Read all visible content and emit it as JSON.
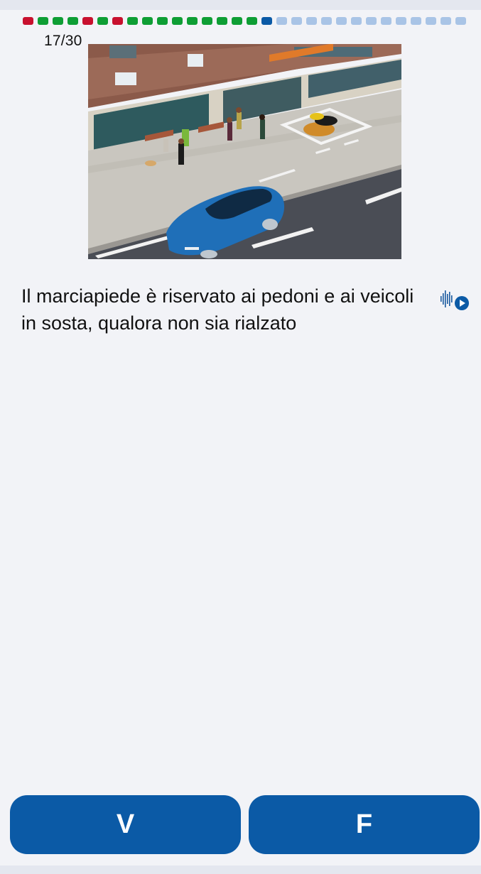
{
  "progress": {
    "counter": "17/30",
    "current": 17,
    "total": 30,
    "states": [
      "wrong",
      "correct",
      "correct",
      "correct",
      "wrong",
      "correct",
      "wrong",
      "correct",
      "correct",
      "correct",
      "correct",
      "correct",
      "correct",
      "correct",
      "correct",
      "correct",
      "current",
      "pending",
      "pending",
      "pending",
      "pending",
      "pending",
      "pending",
      "pending",
      "pending",
      "pending",
      "pending",
      "pending",
      "pending",
      "pending"
    ],
    "colors": {
      "wrong": "#c8102e",
      "correct": "#0e9e34",
      "current": "#0b5aa6",
      "pending": "#a9c4e6"
    }
  },
  "question": {
    "text": "Il marciapiede è riservato ai pedoni e ai veicoli in sosta, qualora non sia rialzato"
  },
  "audio": {
    "icon": "audio-play-icon"
  },
  "answers": {
    "true_label": "V",
    "false_label": "F"
  },
  "colors": {
    "button": "#0b5aa6",
    "background": "#f2f3f7"
  }
}
